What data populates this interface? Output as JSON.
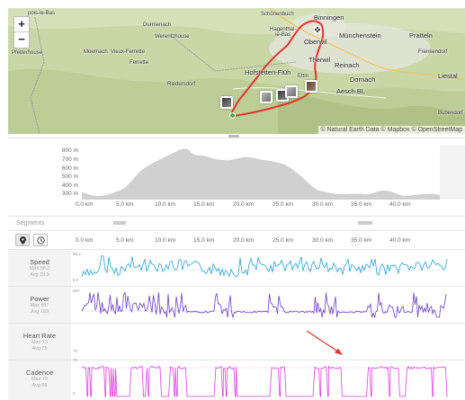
{
  "map": {
    "zoom_in_label": "+",
    "zoom_out_label": "−",
    "places": [
      {
        "key": "pois_le_bas",
        "text": "pois-le-Bas"
      },
      {
        "key": "durmenach",
        "text": "Durmenach"
      },
      {
        "key": "schonenbuch",
        "text": "Schönenbuch"
      },
      {
        "key": "binningen",
        "text": "Binningen"
      },
      {
        "key": "werentzhouse",
        "text": "Werentzhouse"
      },
      {
        "key": "hagenthal",
        "text": "Hagenthal-\nle-Bas"
      },
      {
        "key": "oberwil",
        "text": "Oberwil"
      },
      {
        "key": "munchenstein",
        "text": "Münchenstein"
      },
      {
        "key": "pratteln",
        "text": "Pratteln"
      },
      {
        "key": "pfetterhouse",
        "text": "Pfetterhouse"
      },
      {
        "key": "moernach",
        "text": "Moernach"
      },
      {
        "key": "vieux_ferrette",
        "text": "Vieux-Ferrette"
      },
      {
        "key": "frenkendorf",
        "text": "Frenkendorf"
      },
      {
        "key": "ferrette",
        "text": "Ferrette"
      },
      {
        "key": "therwil",
        "text": "Therwil"
      },
      {
        "key": "reinach",
        "text": "Reinach"
      },
      {
        "key": "liestal",
        "text": "Liestal"
      },
      {
        "key": "hofstetten",
        "text": "Hofstetten-Flüh"
      },
      {
        "key": "dornach",
        "text": "Dornach"
      },
      {
        "key": "riedersdorf",
        "text": "Riedersdorf"
      },
      {
        "key": "aesch",
        "text": "Aesch BL"
      },
      {
        "key": "ettingen",
        "text": "Ettin"
      },
      {
        "key": "bubendorf",
        "text": "Bubendorf"
      }
    ],
    "attribution": "© Natural Earth Data © Mapbox © OpenStreetMap"
  },
  "elevation": {
    "y_ticks": [
      "800 m",
      "700 m",
      "600 m",
      "500 m",
      "400 m",
      "300 m"
    ],
    "x_ticks": [
      "0.0 km",
      "5.0 km",
      "10.0 km",
      "15.0 km",
      "20.0 km",
      "25.0 km",
      "30.0 km",
      "35.0 km",
      "40.0 km"
    ],
    "fill_color": "#d0d0d0"
  },
  "segments": {
    "title": "Segments"
  },
  "streams": {
    "x_ticks": [
      "0.0 km",
      "5.0 km",
      "10.0 km",
      "15.0 km",
      "20.0 km",
      "25.0 km",
      "30.0 km",
      "35.0 km",
      "40.0 km"
    ],
    "rows": [
      {
        "key": "speed",
        "name": "Speed",
        "max": "Max 58.2",
        "avg": "Avg 19.9",
        "scale_top": "58.2",
        "scale_bottom": "0.0",
        "color": "#2a9fd6"
      },
      {
        "key": "power",
        "name": "Power",
        "max": "Max 587",
        "avg": "Avg 183",
        "scale_top": "587",
        "scale_bottom": "",
        "color": "#6a3fc4"
      },
      {
        "key": "heart_rate",
        "name": "Heart Rate",
        "max": "Max 75",
        "avg": "Avg 75",
        "scale_top": "75",
        "scale_bottom": "",
        "color": "#d9534f"
      },
      {
        "key": "cadence",
        "name": "Cadence",
        "max": "Max 79",
        "avg": "Avg 66",
        "scale_top": "79",
        "scale_bottom": "0",
        "color": "#e040e0"
      }
    ]
  },
  "colors": {
    "route": "#e3342f",
    "annotation_arrow": "#e3342f"
  }
}
